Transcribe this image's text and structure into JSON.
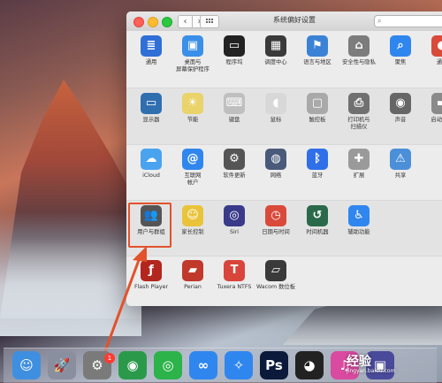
{
  "window": {
    "title": "系统偏好设置",
    "nav_back": "‹",
    "nav_forward": "›",
    "search_glyph": "⌕"
  },
  "rows": [
    [
      {
        "name": "general",
        "label": "通用",
        "color": "#2f6fd6",
        "glyph": "≣"
      },
      {
        "name": "desktop-screensaver",
        "label": "桌面与\n屏幕保护程序",
        "color": "#3a8fe8",
        "glyph": "▣"
      },
      {
        "name": "dock",
        "label": "程序坞",
        "color": "#222",
        "glyph": "▭"
      },
      {
        "name": "mission-control",
        "label": "调度中心",
        "color": "#3a3a3a",
        "glyph": "▦"
      },
      {
        "name": "language-region",
        "label": "语言与地区",
        "color": "#3b82d6",
        "glyph": "⚑"
      },
      {
        "name": "security-privacy",
        "label": "安全性与隐私",
        "color": "#7c7c7c",
        "glyph": "⌂"
      },
      {
        "name": "spotlight",
        "label": "聚焦",
        "color": "#2f86ef",
        "glyph": "⌕"
      },
      {
        "name": "notifications",
        "label": "通知",
        "color": "#d94a3b",
        "glyph": "●"
      }
    ],
    [
      {
        "name": "displays",
        "label": "显示器",
        "color": "#2f6fb0",
        "glyph": "▭"
      },
      {
        "name": "energy-saver",
        "label": "节能",
        "color": "#e9d36a",
        "glyph": "☀"
      },
      {
        "name": "keyboard",
        "label": "键盘",
        "color": "#bfbfbf",
        "glyph": "⌨"
      },
      {
        "name": "mouse",
        "label": "鼠标",
        "color": "#d8d8d8",
        "glyph": "◖"
      },
      {
        "name": "trackpad",
        "label": "触控板",
        "color": "#a9a9a9",
        "glyph": "▢"
      },
      {
        "name": "printers-scanners",
        "label": "打印机与\n扫描仪",
        "color": "#707070",
        "glyph": "⎙"
      },
      {
        "name": "sound",
        "label": "声音",
        "color": "#666",
        "glyph": "◉"
      },
      {
        "name": "startup-disk",
        "label": "启动磁盘",
        "color": "#8a8a8a",
        "glyph": "▬"
      }
    ],
    [
      {
        "name": "icloud",
        "label": "iCloud",
        "color": "#4aa3ef",
        "glyph": "☁"
      },
      {
        "name": "internet-accounts",
        "label": "互联网\n帐户",
        "color": "#2f86ef",
        "glyph": "@"
      },
      {
        "name": "software-update",
        "label": "软件更新",
        "color": "#555",
        "glyph": "⚙"
      },
      {
        "name": "network",
        "label": "网络",
        "color": "#4a5a7a",
        "glyph": "◍"
      },
      {
        "name": "bluetooth",
        "label": "蓝牙",
        "color": "#2f6fe8",
        "glyph": "ᛒ"
      },
      {
        "name": "extensions",
        "label": "扩展",
        "color": "#9a9a9a",
        "glyph": "✚"
      },
      {
        "name": "sharing",
        "label": "共享",
        "color": "#4a8fd8",
        "glyph": "⚠"
      }
    ],
    [
      {
        "name": "users-groups",
        "label": "用户与群组",
        "color": "#555",
        "glyph": "👥"
      },
      {
        "name": "parental-controls",
        "label": "家长控制",
        "color": "#e9c43a",
        "glyph": "☺"
      },
      {
        "name": "siri",
        "label": "Siri",
        "color": "#3a3a8a",
        "glyph": "◎"
      },
      {
        "name": "date-time",
        "label": "日期与时间",
        "color": "#d94a3b",
        "glyph": "◷"
      },
      {
        "name": "time-machine",
        "label": "时间机器",
        "color": "#2a6a4a",
        "glyph": "↺"
      },
      {
        "name": "accessibility",
        "label": "辅助功能",
        "color": "#2f86ef",
        "glyph": "♿"
      }
    ],
    [
      {
        "name": "flash-player",
        "label": "Flash Player",
        "color": "#b3261e",
        "glyph": "ƒ"
      },
      {
        "name": "perian",
        "label": "Perian",
        "color": "#c0392b",
        "glyph": "▰"
      },
      {
        "name": "tuxera-ntfs",
        "label": "Tuxera NTFS",
        "color": "#d9453b",
        "glyph": "T"
      },
      {
        "name": "wacom",
        "label": "Wacom 数位板",
        "color": "#3a3a3a",
        "glyph": "▱"
      }
    ]
  ],
  "dock": [
    {
      "name": "finder",
      "color": "#3f8fe0",
      "glyph": "☺"
    },
    {
      "name": "launchpad",
      "color": "#8a8fa0",
      "glyph": "🚀"
    },
    {
      "name": "system-preferences",
      "color": "#7a7a7a",
      "glyph": "⚙"
    },
    {
      "name": "chrome",
      "color": "#2a9a4a",
      "glyph": "◉"
    },
    {
      "name": "wechat",
      "color": "#2cb34a",
      "glyph": "◎"
    },
    {
      "name": "baidu-netdisk",
      "color": "#2f86ef",
      "glyph": "∞"
    },
    {
      "name": "safari",
      "color": "#2f86ef",
      "glyph": "✧"
    },
    {
      "name": "photoshop",
      "color": "#0b1a3a",
      "glyph": "Ps"
    },
    {
      "name": "qq",
      "color": "#222",
      "glyph": "◕"
    },
    {
      "name": "itunes",
      "color": "#d94aa0",
      "glyph": "♫"
    },
    {
      "name": "screen-app",
      "color": "#4a4a9a",
      "glyph": "▣"
    }
  ],
  "dock_badge": "1",
  "watermark": {
    "text": "经验",
    "sub": "jingyan.baidu.com"
  }
}
